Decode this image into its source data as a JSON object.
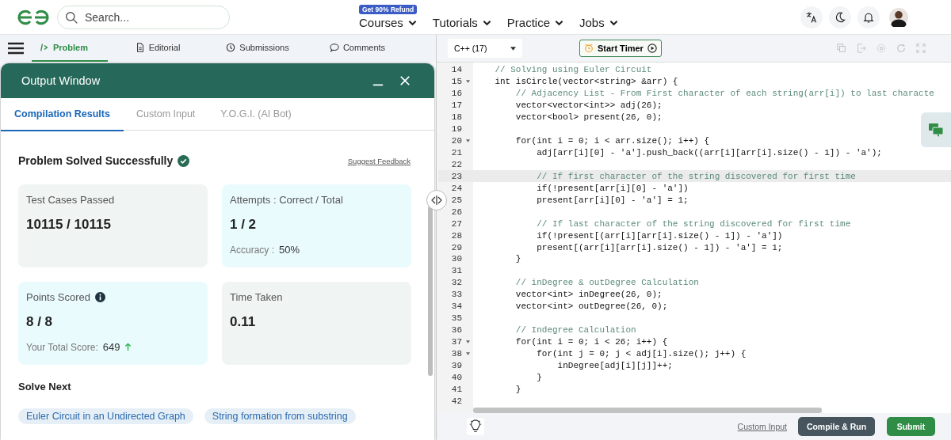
{
  "header": {
    "search": {
      "placeholder": "Search..."
    },
    "nav": [
      {
        "label": "Courses",
        "badge": "Get 90% Refund"
      },
      {
        "label": "Tutorials"
      },
      {
        "label": "Practice"
      },
      {
        "label": "Jobs"
      }
    ]
  },
  "problem_tabs": [
    {
      "label": "Problem",
      "selected": true
    },
    {
      "label": "Editorial",
      "selected": false
    },
    {
      "label": "Submissions",
      "selected": false
    },
    {
      "label": "Comments",
      "selected": false
    }
  ],
  "output_window": {
    "title": "Output Window",
    "tabs": [
      {
        "label": "Compilation Results",
        "selected": true
      },
      {
        "label": "Custom Input",
        "selected": false
      },
      {
        "label": "Y.O.G.I. (AI Bot)",
        "selected": false
      }
    ],
    "status": "Problem Solved Successfully",
    "feedback_link": "Suggest Feedback",
    "cards": [
      {
        "label": "Test Cases Passed",
        "value": "10115 / 10115",
        "color": "#f0f5f4"
      },
      {
        "label": "Attempts : Correct / Total",
        "value": "1 / 2",
        "note_label": "Accuracy :",
        "note_value": "50%",
        "color": "#eafbfe"
      },
      {
        "label": "Points Scored",
        "value": "8 / 8",
        "info": true,
        "note_label": "Your Total Score:",
        "note_value": "649",
        "trend_up": true,
        "color": "#eafbfe"
      },
      {
        "label": "Time Taken",
        "value": "0.11",
        "color": "#f0f5f4"
      }
    ],
    "solve_next_title": "Solve Next",
    "solve_next": [
      "Euler Circuit in an Undirected Graph",
      "String formation from substring"
    ]
  },
  "editor": {
    "language": "C++ (17)",
    "timer_button": "Start Timer",
    "lines": [
      {
        "number": "14",
        "kind": "comment",
        "text": "    // Solving using Euler Circuit",
        "foldable": false,
        "selected": false
      },
      {
        "number": "15",
        "kind": "code",
        "text": "    int isCircle(vector<string> &arr) {",
        "foldable": true,
        "selected": false
      },
      {
        "number": "16",
        "kind": "comment",
        "text": "        // Adjacency List - From First character of each string(arr[i]) to last characte",
        "foldable": false,
        "selected": false
      },
      {
        "number": "17",
        "kind": "code",
        "text": "        vector<vector<int>> adj(26);",
        "foldable": false,
        "selected": false
      },
      {
        "number": "18",
        "kind": "code",
        "text": "        vector<bool> present(26, 0);",
        "foldable": false,
        "selected": false
      },
      {
        "number": "19",
        "foldable": false,
        "selected": false
      },
      {
        "number": "20",
        "kind": "code",
        "text": "        for(int i = 0; i < arr.size(); i++) {",
        "foldable": true,
        "selected": false
      },
      {
        "number": "21",
        "kind": "code",
        "text": "            adj[arr[i][0] - 'a'].push_back((arr[i][arr[i].size() - 1]) - 'a');",
        "foldable": false,
        "selected": false
      },
      {
        "number": "22",
        "foldable": false,
        "selected": false
      },
      {
        "number": "23",
        "kind": "comment",
        "text": "            // If first character of the string discovered for first time",
        "foldable": false,
        "selected": true
      },
      {
        "number": "24",
        "kind": "code",
        "text": "            if(!present[arr[i][0] - 'a'])",
        "foldable": false,
        "selected": false
      },
      {
        "number": "25",
        "kind": "code",
        "text": "            present[arr[i][0] - 'a'] = 1;",
        "foldable": false,
        "selected": false
      },
      {
        "number": "26",
        "foldable": false,
        "selected": false
      },
      {
        "number": "27",
        "kind": "comment",
        "text": "            // If last character of the string discovered for first time",
        "foldable": false,
        "selected": false
      },
      {
        "number": "28",
        "kind": "code",
        "text": "            if(!present[(arr[i][arr[i].size() - 1]) - 'a'])",
        "foldable": false,
        "selected": false
      },
      {
        "number": "29",
        "kind": "code",
        "text": "            present[(arr[i][arr[i].size() - 1]) - 'a'] = 1;",
        "foldable": false,
        "selected": false
      },
      {
        "number": "30",
        "kind": "code",
        "text": "        }",
        "foldable": false,
        "selected": false
      },
      {
        "number": "31",
        "foldable": false,
        "selected": false
      },
      {
        "number": "32",
        "kind": "comment",
        "text": "        // inDegree & outDegree Calculation",
        "foldable": false,
        "selected": false
      },
      {
        "number": "33",
        "kind": "code",
        "text": "        vector<int> inDegree(26, 0);",
        "foldable": false,
        "selected": false
      },
      {
        "number": "34",
        "kind": "code",
        "text": "        vector<int> outDegree(26, 0);",
        "foldable": false,
        "selected": false
      },
      {
        "number": "35",
        "foldable": false,
        "selected": false
      },
      {
        "number": "36",
        "kind": "comment",
        "text": "        // Indegree Calculation",
        "foldable": false,
        "selected": false
      },
      {
        "number": "37",
        "kind": "code",
        "text": "        for(int i = 0; i < 26; i++) {",
        "foldable": true,
        "selected": false
      },
      {
        "number": "38",
        "kind": "code",
        "text": "            for(int j = 0; j < adj[i].size(); j++) {",
        "foldable": true,
        "selected": false
      },
      {
        "number": "39",
        "kind": "code",
        "text": "                inDegree[adj[i][j]]++;",
        "foldable": false,
        "selected": false
      },
      {
        "number": "40",
        "kind": "code",
        "text": "            }",
        "foldable": false,
        "selected": false
      },
      {
        "number": "41",
        "kind": "code",
        "text": "        }",
        "foldable": false,
        "selected": false
      },
      {
        "number": "42",
        "foldable": false,
        "selected": false
      }
    ],
    "custom_input_link": "Custom Input",
    "compile_button": "Compile & Run",
    "submit_button": "Submit"
  }
}
